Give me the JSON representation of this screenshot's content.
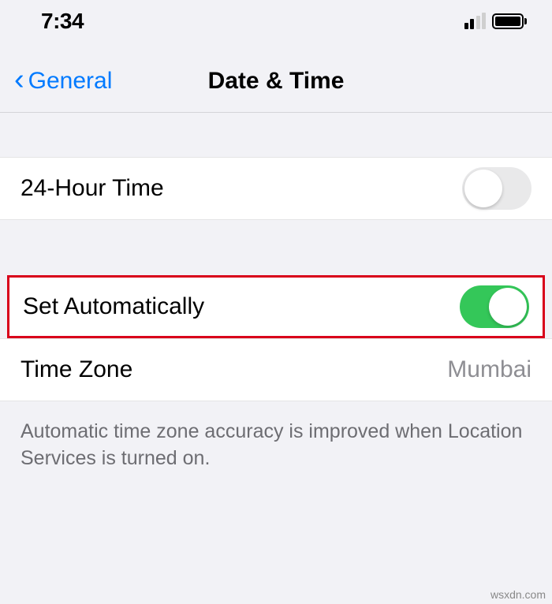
{
  "statusBar": {
    "time": "7:34"
  },
  "nav": {
    "backLabel": "General",
    "title": "Date & Time"
  },
  "rows": {
    "twentyFourHour": {
      "label": "24-Hour Time",
      "enabled": false
    },
    "setAutomatically": {
      "label": "Set Automatically",
      "enabled": true
    },
    "timeZone": {
      "label": "Time Zone",
      "value": "Mumbai"
    }
  },
  "footerNote": "Automatic time zone accuracy is improved when Location Services is turned on.",
  "watermark": "wsxdn.com"
}
